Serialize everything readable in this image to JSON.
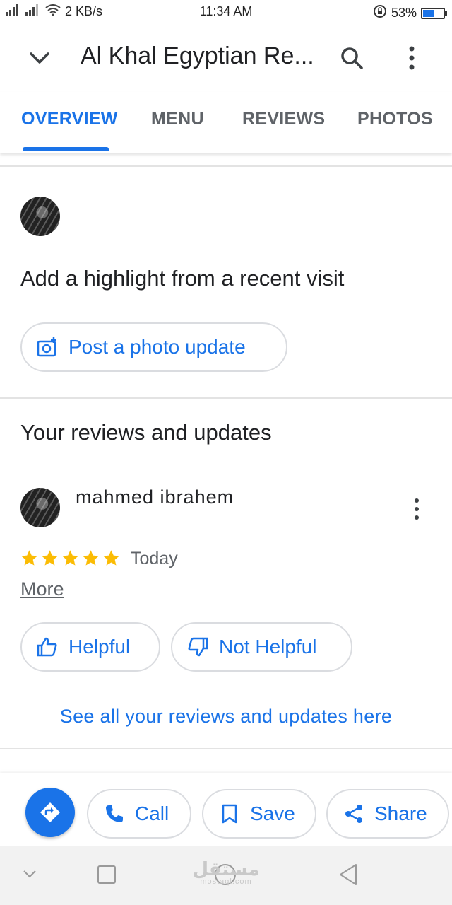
{
  "status_bar": {
    "signal_1": "3G",
    "signal_2": "3G",
    "speed": "2 KB/s",
    "time": "11:34 AM",
    "battery": "53%",
    "battery_level": 0.53
  },
  "app_bar": {
    "title": "Al Khal Egyptian Re..."
  },
  "tabs": [
    {
      "label": "OVERVIEW",
      "active": true
    },
    {
      "label": "MENU",
      "active": false
    },
    {
      "label": "REVIEWS",
      "active": false
    },
    {
      "label": "PHOTOS",
      "active": false
    }
  ],
  "highlight": {
    "heading": "Add a highlight from a recent visit",
    "post_button": "Post a photo update"
  },
  "reviews_section": {
    "heading": "Your reviews and updates",
    "review": {
      "author": "mahmed ibrahem",
      "rating": 5,
      "date": "Today",
      "more_link": "More",
      "helpful": "Helpful",
      "not_helpful": "Not Helpful"
    },
    "see_all": "See all your reviews and updates here"
  },
  "actions": {
    "call": "Call",
    "save": "Save",
    "share": "Share"
  },
  "colors": {
    "accent": "#1a73e8",
    "star": "#fbbc04",
    "divider": "#e3e3e3"
  },
  "watermark": {
    "text": "مستقل",
    "sub": "mostaql.com"
  }
}
